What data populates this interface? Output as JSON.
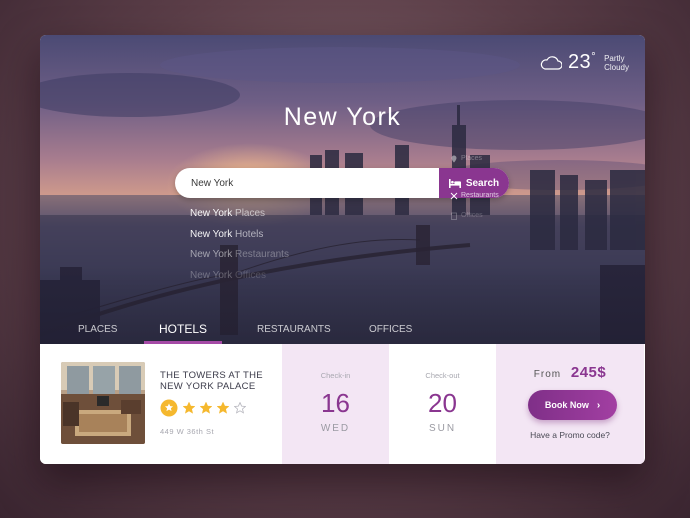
{
  "weather": {
    "icon": "cloud-icon",
    "temperature": "23",
    "degree": "°",
    "condition_line1": "Partly",
    "condition_line2": "Cloudy"
  },
  "hero": {
    "city": "New York"
  },
  "search": {
    "value": "New York",
    "button_label": "Search",
    "suggestions": [
      {
        "match": "New York",
        "rest": " Places"
      },
      {
        "match": "New York",
        "rest": " Hotels"
      },
      {
        "match": "New York",
        "rest": " Restaurants"
      },
      {
        "match": "New York",
        "rest": " Offices"
      }
    ]
  },
  "side_categories": [
    "Places",
    "Restaurants",
    "Offices"
  ],
  "tabs": [
    "PLACES",
    "HOTELS",
    "RESTAURANTS",
    "OFFICES"
  ],
  "active_tab": "HOTELS",
  "hotel": {
    "name_line1": "THE TOWERS AT THE",
    "name_line2": "NEW YORK PALACE",
    "rating": 4,
    "max_rating": 5,
    "address": "449 W 36th St"
  },
  "checkin": {
    "label": "Check-in",
    "day": "16",
    "weekday": "WED"
  },
  "checkout": {
    "label": "Check-out",
    "day": "20",
    "weekday": "SUN"
  },
  "booking": {
    "from_label": "From",
    "price": "245$",
    "button_label": "Book Now",
    "promo_text": "Have a Promo code?"
  },
  "colors": {
    "accent": "#8a3690",
    "accent_light_bg": "#f3e6f4",
    "star": "#f5b82e"
  }
}
